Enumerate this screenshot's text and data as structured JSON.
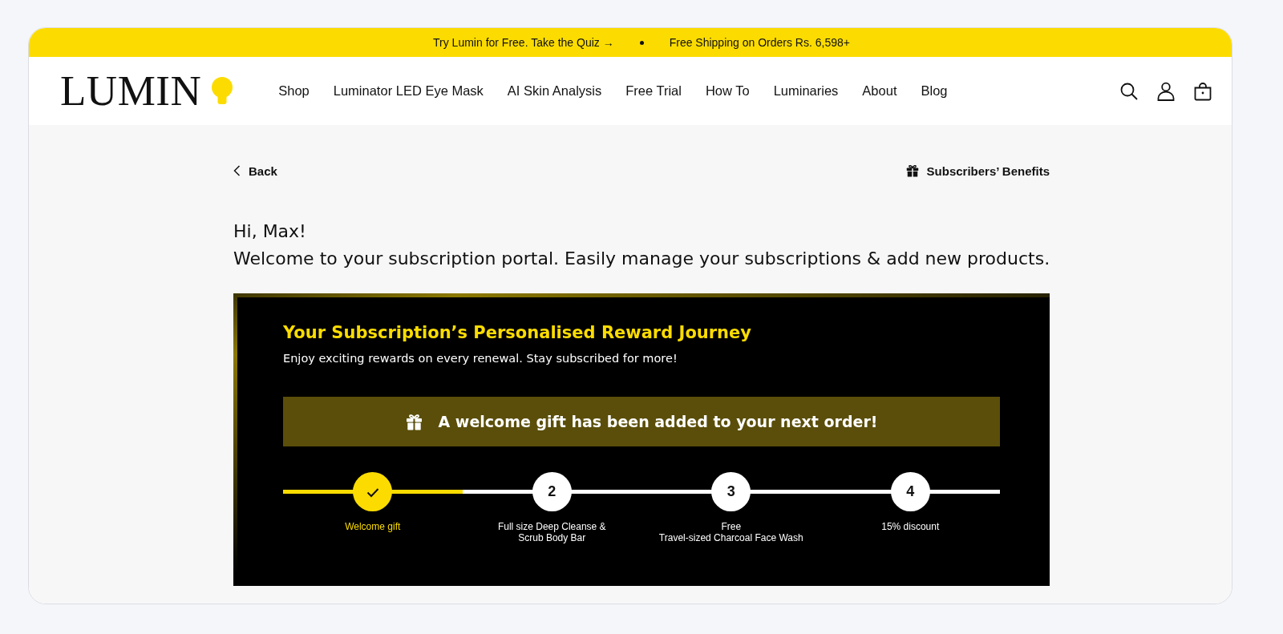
{
  "announcement_bar": {
    "messages": [
      "Try Lumin for Free. Take the Quiz →",
      "Free Shipping on Orders Rs. 6,598+"
    ]
  },
  "header": {
    "logo": "LUMIN",
    "nav": [
      "Shop",
      "Luminator LED Eye Mask",
      "AI Skin Analysis",
      "Free Trial",
      "How To",
      "Luminaries",
      "About",
      "Blog"
    ]
  },
  "back_link": "Back",
  "benefits_link": "Subscribers’ Benefits",
  "greeting": "Hi, Max!",
  "intro": "Welcome to your subscription portal. Easily manage your subscriptions & add new products.",
  "reward_journey": {
    "title": "Your Subscription’s Personalised Reward Journey",
    "subtitle": "Enjoy exciting rewards on every renewal. Stay subscribed for more!",
    "banner": "A welcome gift has been added to your next order!",
    "progress": {
      "level": 0.25
    },
    "steps": [
      {
        "label": "Welcome gift",
        "completed": true
      },
      {
        "number": "2",
        "label": "Full size Deep Cleanse &\nScrub Body Bar",
        "completed": false
      },
      {
        "number": "3",
        "label": "Free\nTravel-sized Charcoal Face Wash",
        "completed": false
      },
      {
        "number": "4",
        "label": "15% discount",
        "completed": false
      }
    ]
  }
}
